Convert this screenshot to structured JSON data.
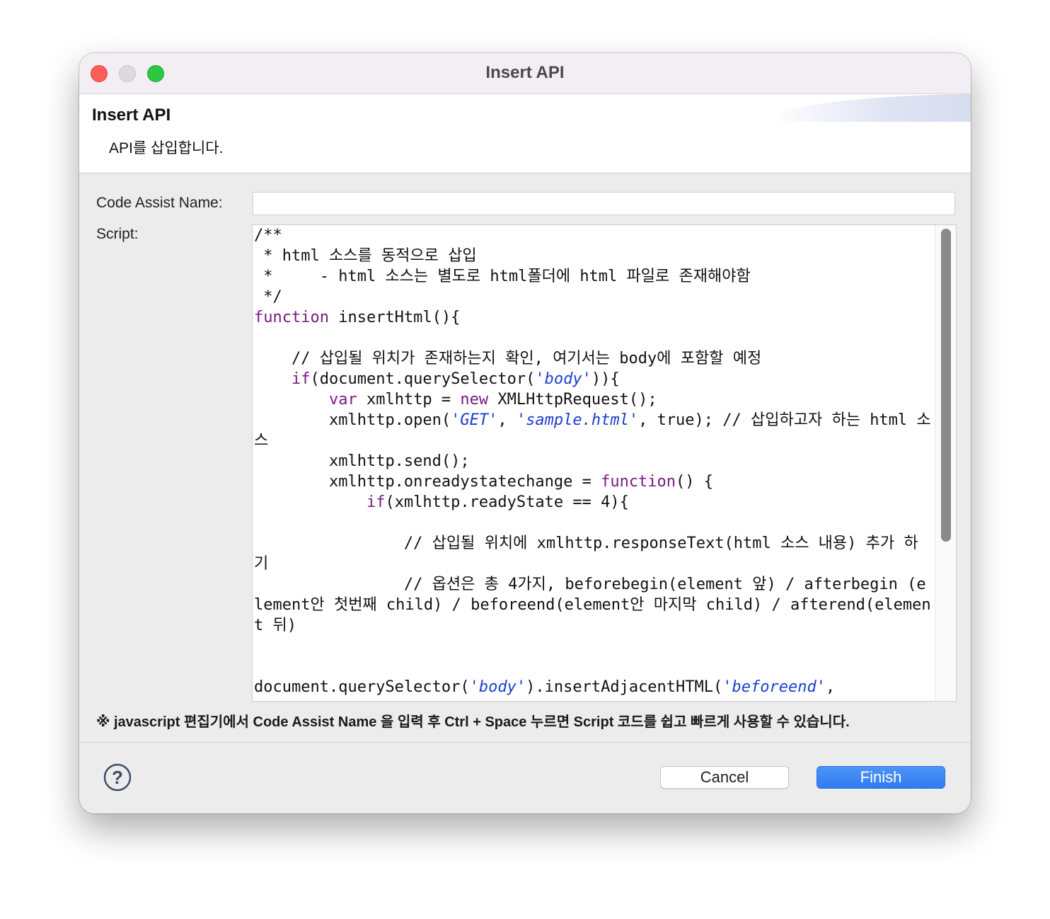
{
  "window": {
    "title": "Insert API"
  },
  "header": {
    "title": "Insert API",
    "description": "API를 삽입합니다."
  },
  "form": {
    "code_assist_label": "Code Assist Name:",
    "code_assist_value": "",
    "script_label": "Script:"
  },
  "script": {
    "lines": [
      [
        {
          "t": "/**"
        }
      ],
      [
        {
          "t": " * html 소스를 동적으로 삽입"
        }
      ],
      [
        {
          "t": " *     - html 소스는 별도로 html폴더에 html 파일로 존재해야함"
        }
      ],
      [
        {
          "t": " */"
        }
      ],
      [
        {
          "t": "function",
          "c": "kw"
        },
        {
          "t": " insertHtml(){"
        }
      ],
      [
        {
          "t": ""
        }
      ],
      [
        {
          "t": "    // 삽입될 위치가 존재하는지 확인, 여기서는 body에 포함할 예정"
        }
      ],
      [
        {
          "t": "    "
        },
        {
          "t": "if",
          "c": "kw"
        },
        {
          "t": "(document.querySelector("
        },
        {
          "t": "'body'",
          "c": "str"
        },
        {
          "t": ")){"
        }
      ],
      [
        {
          "t": "        "
        },
        {
          "t": "var",
          "c": "kw"
        },
        {
          "t": " xmlhttp = "
        },
        {
          "t": "new",
          "c": "kw"
        },
        {
          "t": " XMLHttpRequest();"
        }
      ],
      [
        {
          "t": "        xmlhttp.open("
        },
        {
          "t": "'GET'",
          "c": "str"
        },
        {
          "t": ", "
        },
        {
          "t": "'sample.html'",
          "c": "str"
        },
        {
          "t": ", true); // 삽입하고자 하는 html 소스"
        }
      ],
      [
        {
          "t": "        xmlhttp.send();"
        }
      ],
      [
        {
          "t": "        xmlhttp.onreadystatechange = "
        },
        {
          "t": "function",
          "c": "kw"
        },
        {
          "t": "() {"
        }
      ],
      [
        {
          "t": "            "
        },
        {
          "t": "if",
          "c": "kw"
        },
        {
          "t": "(xmlhttp.readyState == 4){"
        }
      ],
      [
        {
          "t": ""
        }
      ],
      [
        {
          "t": "                // 삽입될 위치에 xmlhttp.responseText(html 소스 내용) 추가 하기"
        }
      ],
      [
        {
          "t": "                // 옵션은 총 4가지, beforebegin(element 앞) / afterbegin (element안 첫번째 child) / beforeend(element안 마지막 child) / afterend(element 뒤)"
        }
      ],
      [
        {
          "t": ""
        }
      ],
      [
        {
          "t": ""
        }
      ],
      [
        {
          "t": "document.querySelector("
        },
        {
          "t": "'body'",
          "c": "str"
        },
        {
          "t": ").insertAdjacentHTML("
        },
        {
          "t": "'beforeend'",
          "c": "str"
        },
        {
          "t": ","
        }
      ]
    ]
  },
  "note": "※ javascript 편집기에서 Code Assist Name 을 입력 후 Ctrl + Space 누르면 Script 코드를 쉽고 빠르게 사용할 수 있습니다.",
  "buttons": {
    "cancel": "Cancel",
    "finish": "Finish"
  },
  "icons": {
    "help": "help-icon"
  },
  "colors": {
    "accent": "#3a86f5",
    "keyword": "#7a1a82",
    "string": "#1a3fd0"
  }
}
